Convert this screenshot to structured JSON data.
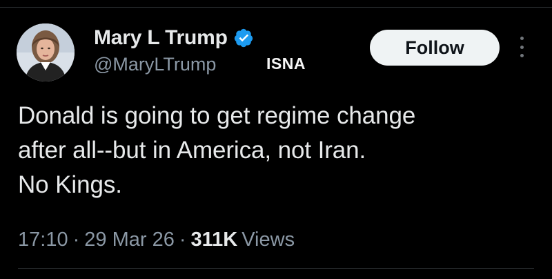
{
  "profile": {
    "display_name": "Mary L Trump",
    "handle": "@MaryLTrump",
    "verified": true,
    "verified_icon": "verified-badge-icon",
    "avatar_icon": "profile-photo"
  },
  "watermark": {
    "text": "ISNA"
  },
  "header": {
    "follow_label": "Follow",
    "more_icon": "more-vertical-icon"
  },
  "tweet": {
    "lines": [
      "Donald is going to get regime change",
      "after all--but in America, not Iran.",
      "No Kings."
    ]
  },
  "meta": {
    "time": "17:10",
    "separator": "·",
    "date": "29 Mar 26",
    "views_count": "311K",
    "views_label": "Views"
  },
  "colors": {
    "background": "#000000",
    "primary_text": "#e7e9ea",
    "secondary_text": "#8b98a5",
    "verified_blue": "#1d9bf0",
    "follow_button_bg": "#eff3f4",
    "follow_button_text": "#0f1419",
    "divider": "#2f3336"
  }
}
